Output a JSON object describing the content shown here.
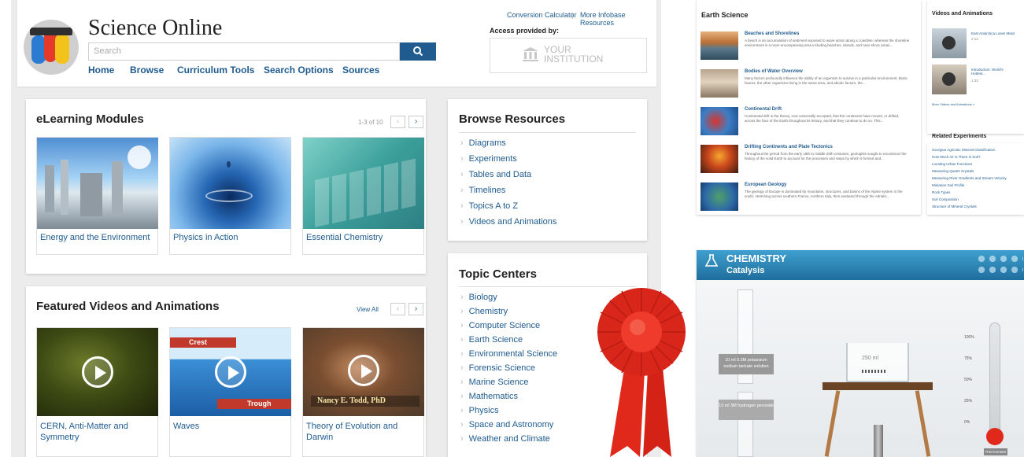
{
  "header": {
    "title": "Science Online",
    "search_placeholder": "Search",
    "nav": [
      "Home",
      "Browse",
      "Curriculum Tools",
      "Search Options",
      "Sources"
    ],
    "toplink_1": "Conversion Calculator",
    "toplink_sep": "|",
    "toplink_2": "More Infobase Resources",
    "access_label": "Access provided by:",
    "institution_line1": "YOUR",
    "institution_line2": "INSTITUTION"
  },
  "elearning": {
    "title": "eLearning Modules",
    "pager": "1-3 of 10",
    "items": [
      {
        "label": "Energy and the Environment"
      },
      {
        "label": "Physics in Action"
      },
      {
        "label": "Essential Chemistry"
      }
    ]
  },
  "featured": {
    "title": "Featured Videos and Animations",
    "view_all": "View All",
    "items": [
      {
        "label": "CERN, Anti-Matter and Symmetry"
      },
      {
        "label": "Waves"
      },
      {
        "label": "Theory of Evolution and Darwin"
      }
    ],
    "wave_label_crest": "Crest",
    "wave_label_trough": "Trough",
    "caption_name": "Nancy E. Todd, PhD"
  },
  "browse": {
    "title": "Browse Resources",
    "items": [
      "Diagrams",
      "Experiments",
      "Tables and Data",
      "Timelines",
      "Topics A to Z",
      "Videos and Animations"
    ]
  },
  "topics": {
    "title": "Topic Centers",
    "items": [
      "Biology",
      "Chemistry",
      "Computer Science",
      "Earth Science",
      "Environmental Science",
      "Forensic Science",
      "Marine Science",
      "Mathematics",
      "Physics",
      "Space and Astronomy",
      "Weather and Climate"
    ]
  },
  "earth": {
    "title": "Earth Science",
    "items": [
      {
        "title": "Beaches and Shorelines",
        "desc": "A beach is an accumulation of sediment exposed to wave action along a coastline, whereas the shoreline environment is a more encompassing area including beaches, islands, and near-shore areas..."
      },
      {
        "title": "Bodies of Water Overview",
        "desc": "Many factors profoundly influence the ability of an organism to survive in a particular environment. Biotic factors, the other organisms living in the same area, and abiotic factors, the..."
      },
      {
        "title": "Continental Drift",
        "desc": "Continental drift is the theory, now universally accepted, that the continents have moved, or drifted, across the face of the Earth throughout its history, and that they continue to do so. This..."
      },
      {
        "title": "Drifting Continents and Plate Tectonics",
        "desc": "Throughout the period from the early 18th to middle 20th centuries, geologists sought to reconstruct the history of the solid Earth to account for the processes and steps by which it formed and..."
      },
      {
        "title": "European Geology",
        "desc": "The geology of Europe is dominated by mountains, structures, and basins of the Alpine system in the south, stretching across southern France, northern Italy, then eastward through the Adriatic..."
      }
    ]
  },
  "videos_side": {
    "title": "Videos and Animations",
    "items": [
      {
        "title": "East Antarctica Loses Mass",
        "meta": "2:13"
      },
      {
        "title": "Introduction: World's Hottest...",
        "meta": "1:33"
      }
    ],
    "more": "More Videos and Animations »"
  },
  "related": {
    "title": "Related Experiments",
    "items": [
      "Georgius Agricola: Mineral Classification",
      "How Much Air Is There in Soil?",
      "Locating Urban Functions",
      "Measuring Quartz Crystals",
      "Measuring River Gradients and Stream Velocity",
      "Miniature Soil Profile",
      "Rock Types",
      "Soil Composition",
      "Structure of Mineral Crystals"
    ]
  },
  "chem": {
    "title": "CHEMISTRY",
    "subtitle": "Catalysis",
    "label_1": "10 ml 0.3M potassium sodium tartrate solution",
    "label_2": "10 ml 3M hydrogen peroxide",
    "beaker": "250 ml",
    "therm_marks": [
      "100%",
      "75%",
      "50%",
      "25%",
      "0%"
    ],
    "therm_label": "Thermometer"
  },
  "colors": {
    "link": "#1f5b8e",
    "button": "#1f5b8e",
    "ribbon": "#e0291b",
    "chem_bar": "#2d86b5"
  }
}
